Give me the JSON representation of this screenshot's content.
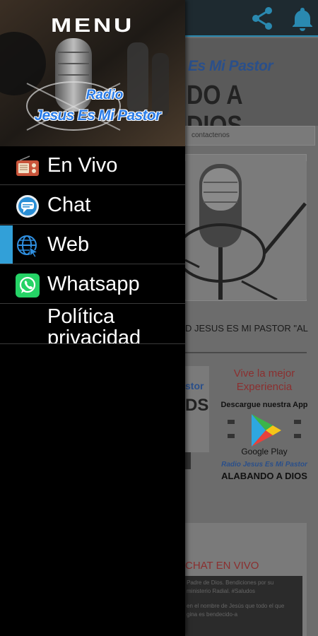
{
  "background": {
    "hero_title": "Es Mi Pastor",
    "hero_subtitle": "DO A DIOS",
    "nav_link": "contactenos",
    "caption": "D JESUS ES MI PASTOR \"AL",
    "promo_left_title": "stor",
    "promo_left_sub": "DS",
    "promo": {
      "line1": "Vive la mejor",
      "line2": "Experiencia",
      "download": "Descargue nuestra App",
      "store": "Google Play",
      "station": "Radio Jesus Es Mi Pastor",
      "slogan": "ALABANDO A DIOS"
    },
    "chat_title": "CHAT EN VIVO",
    "chat_lines": [
      "Padre de Dios. Bendiciones por su",
      "ministerio Radial. #Saludos",
      "en el nombre de Jesús que todo el que",
      "gina es bendecido-a"
    ]
  },
  "drawer": {
    "header": {
      "title": "MENU",
      "radio": "Radio",
      "station": "Jesus Es Mi Pastor"
    },
    "items": [
      {
        "label": "En Vivo",
        "icon": "radio-icon",
        "selected": false
      },
      {
        "label": "Chat",
        "icon": "chat-bubble-icon",
        "selected": false
      },
      {
        "label": "Web",
        "icon": "globe-icon",
        "selected": true
      },
      {
        "label": "Whatsapp",
        "icon": "whatsapp-icon",
        "selected": false
      },
      {
        "label": "Política privacidad",
        "icon": "",
        "selected": false
      }
    ]
  },
  "colors": {
    "accent": "#32a0d8",
    "drawer_bg": "#000000",
    "brand_blue": "#2b7de9"
  }
}
